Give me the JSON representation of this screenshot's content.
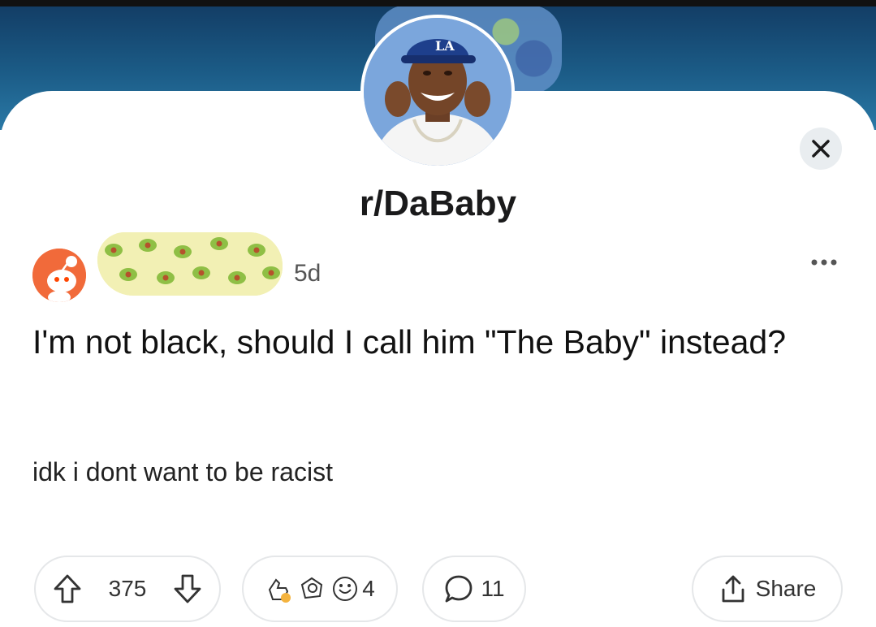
{
  "subreddit": {
    "name": "r/DaBaby"
  },
  "post": {
    "age": "5d",
    "title": "I'm not black, should I call him \"The Baby\" instead?",
    "body": "idk i dont want to be racist"
  },
  "actions": {
    "vote_count": "375",
    "award_count": "4",
    "comment_count": "11",
    "share_label": "Share"
  },
  "icons": {
    "close": "close-icon",
    "more": "more-horizontal-icon",
    "upvote": "upvote-arrow-icon",
    "downvote": "downvote-arrow-icon",
    "comments": "speech-bubble-icon",
    "share": "share-upload-icon"
  },
  "colors": {
    "banner": "#1b5b86",
    "card": "#ffffff",
    "text": "#1a1a1b",
    "pill_border": "#e5e7e9",
    "author_avatar": "#f16a3a",
    "redaction": "#f2f0b4"
  }
}
